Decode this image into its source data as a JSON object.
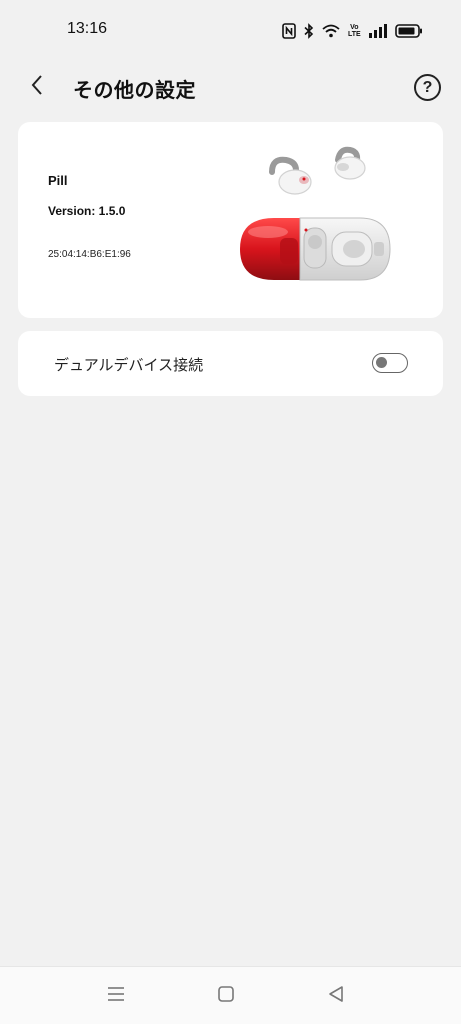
{
  "status_bar": {
    "time": "13:16",
    "icons": [
      "nfc-icon",
      "bluetooth-icon",
      "wifi-icon",
      "volte-icon",
      "signal-icon",
      "battery-icon"
    ],
    "volte_top": "Vo",
    "volte_bottom": "LTE"
  },
  "header": {
    "title": "その他の設定",
    "help_label": "?"
  },
  "device": {
    "name": "Pill",
    "version": "Version: 1.5.0",
    "mac": "25:04:14:B6:E1:96",
    "accent_color": "#d8141c"
  },
  "dual_device": {
    "label": "デュアルデバイス接続",
    "enabled": false
  },
  "nav": {
    "items": [
      "menu-icon",
      "home-icon",
      "back-triangle-icon"
    ]
  }
}
